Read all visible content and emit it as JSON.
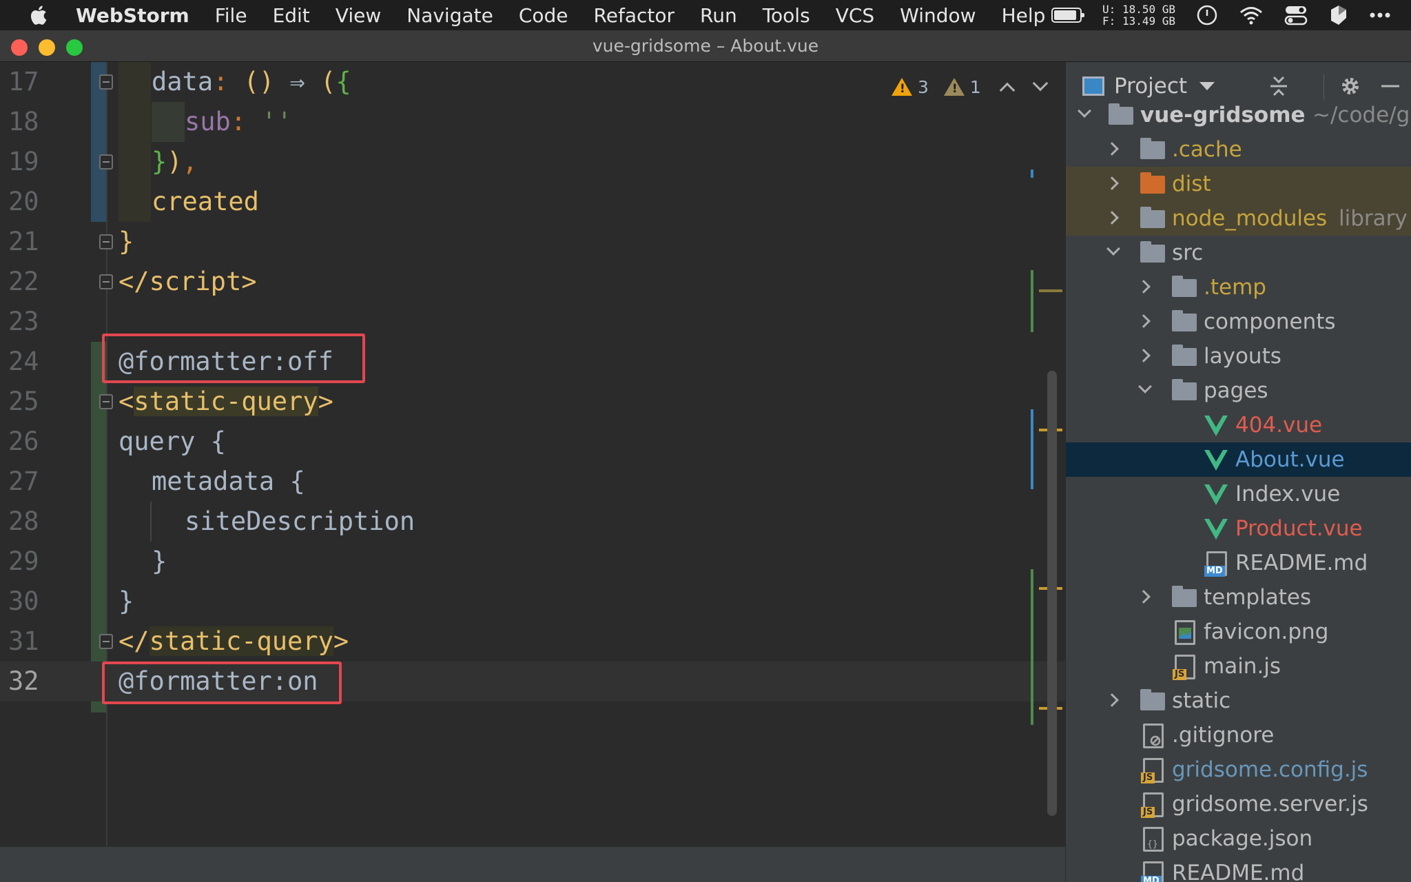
{
  "menubar": {
    "app_name": "WebStorm",
    "items": [
      "File",
      "Edit",
      "View",
      "Navigate",
      "Code",
      "Refactor",
      "Run",
      "Tools",
      "VCS",
      "Window",
      "Help"
    ],
    "disk_u_label": "U:",
    "disk_u_value": "18.50 GB",
    "disk_f_label": "F:",
    "disk_f_value": "13.49 GB"
  },
  "window": {
    "title": "vue-gridsome – About.vue"
  },
  "inspections": {
    "warnings": "3",
    "weak_warnings": "1"
  },
  "editor": {
    "lines": [
      {
        "num": "17",
        "parts": [
          {
            "t": "data",
            "c": "t-key"
          },
          {
            "t": ": ",
            "c": "t-punc"
          },
          {
            "t": "()",
            "c": "t-paren"
          },
          {
            "t": " ⇒ ",
            "c": "t-arrow"
          },
          {
            "t": "(",
            "c": "t-paren"
          },
          {
            "t": "{",
            "c": "t-green"
          }
        ]
      },
      {
        "num": "18",
        "parts": [
          {
            "t": "sub",
            "c": "t-purple"
          },
          {
            "t": ": ",
            "c": "t-punc"
          },
          {
            "t": "''",
            "c": "t-str"
          }
        ]
      },
      {
        "num": "19",
        "parts": [
          {
            "t": "}",
            "c": "t-green"
          },
          {
            "t": ")",
            "c": "t-paren"
          },
          {
            "t": ",",
            "c": "t-punc"
          }
        ]
      },
      {
        "num": "20",
        "parts": [
          {
            "t": "created",
            "c": "t-yellow"
          }
        ]
      },
      {
        "num": "21",
        "parts": [
          {
            "t": "}",
            "c": "t-yellow"
          }
        ]
      },
      {
        "num": "22",
        "parts": [
          {
            "t": "</",
            "c": "t-yellow"
          },
          {
            "t": "script",
            "c": "t-yellow"
          },
          {
            "t": ">",
            "c": "t-yellow"
          }
        ]
      },
      {
        "num": "23",
        "parts": []
      },
      {
        "num": "24",
        "parts": [
          {
            "t": "@formatter:off",
            "c": "t-plain"
          }
        ]
      },
      {
        "num": "25",
        "parts": [
          {
            "t": "<",
            "c": "t-yellow"
          },
          {
            "t": "static-query",
            "c": "t-yellow"
          },
          {
            "t": ">",
            "c": "t-yellow"
          }
        ]
      },
      {
        "num": "26",
        "parts": [
          {
            "t": "query {",
            "c": "t-plain"
          }
        ]
      },
      {
        "num": "27",
        "parts": [
          {
            "t": "metadata {",
            "c": "t-plain"
          }
        ]
      },
      {
        "num": "28",
        "parts": [
          {
            "t": "siteDescription",
            "c": "t-plain"
          }
        ]
      },
      {
        "num": "29",
        "parts": [
          {
            "t": "}",
            "c": "t-plain"
          }
        ]
      },
      {
        "num": "30",
        "parts": [
          {
            "t": "}",
            "c": "t-plain"
          }
        ]
      },
      {
        "num": "31",
        "parts": [
          {
            "t": "</",
            "c": "t-yellow"
          },
          {
            "t": "static-query",
            "c": "t-yellow"
          },
          {
            "t": ">",
            "c": "t-yellow"
          }
        ]
      },
      {
        "num": "32",
        "parts": [
          {
            "t": "@formatter:on",
            "c": "t-plain"
          }
        ]
      }
    ]
  },
  "project": {
    "title": "Project",
    "tree": [
      {
        "label": "vue-gridsome",
        "extra": "~/code/g",
        "type": "folder",
        "open": true,
        "style": "c-bold"
      },
      {
        "label": ".cache",
        "type": "folder",
        "style": "c-yellow"
      },
      {
        "label": "dist",
        "type": "folder-orange",
        "style": "c-yellow",
        "ignored": true
      },
      {
        "label": "node_modules",
        "extra": "library",
        "type": "folder",
        "style": "c-yellow",
        "ignored": true
      },
      {
        "label": "src",
        "type": "folder",
        "open": true,
        "style": "c-normal"
      },
      {
        "label": ".temp",
        "type": "folder",
        "style": "c-yellow"
      },
      {
        "label": "components",
        "type": "folder",
        "style": "c-normal"
      },
      {
        "label": "layouts",
        "type": "folder",
        "style": "c-normal"
      },
      {
        "label": "pages",
        "type": "folder",
        "open": true,
        "style": "c-normal"
      },
      {
        "label": "404.vue",
        "type": "vue",
        "style": "c-red"
      },
      {
        "label": "About.vue",
        "type": "vue",
        "style": "c-blue2",
        "selected": true
      },
      {
        "label": "Index.vue",
        "type": "vue",
        "style": "c-normal"
      },
      {
        "label": "Product.vue",
        "type": "vue",
        "style": "c-red"
      },
      {
        "label": "README.md",
        "type": "md",
        "style": "c-normal",
        "badge": "MD"
      },
      {
        "label": "templates",
        "type": "folder",
        "style": "c-normal"
      },
      {
        "label": "favicon.png",
        "type": "img",
        "style": "c-normal"
      },
      {
        "label": "main.js",
        "type": "js",
        "style": "c-normal",
        "badge": "JS"
      },
      {
        "label": "static",
        "type": "folder",
        "style": "c-normal"
      },
      {
        "label": ".gitignore",
        "type": "file",
        "style": "c-normal"
      },
      {
        "label": "gridsome.config.js",
        "type": "js",
        "style": "c-blue",
        "badge": "JS"
      },
      {
        "label": "gridsome.server.js",
        "type": "js",
        "style": "c-normal",
        "badge": "JS"
      },
      {
        "label": "package.json",
        "type": "file",
        "style": "c-normal"
      },
      {
        "label": "README.md",
        "type": "md",
        "style": "c-normal",
        "badge": "MD"
      }
    ]
  }
}
